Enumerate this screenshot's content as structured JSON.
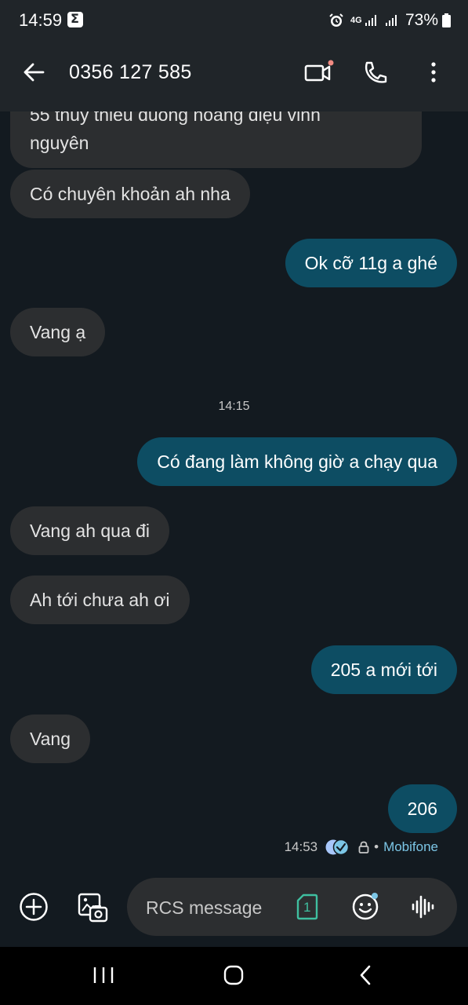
{
  "status_bar": {
    "time": "14:59",
    "network": "4G",
    "battery": "73%"
  },
  "header": {
    "contact": "0356 127 585",
    "icons": [
      "back-arrow-icon",
      "video-call-icon",
      "phone-icon",
      "more-vert-icon"
    ]
  },
  "messages": [
    {
      "direction": "incoming",
      "text_lines": [
        "55 thuy thieu duong hoang diệu vinh",
        "nguyên"
      ]
    },
    {
      "direction": "incoming",
      "text": "Có chuyên khoản ah nha"
    },
    {
      "direction": "outgoing",
      "text": "Ok cỡ 11g a ghé"
    },
    {
      "direction": "incoming",
      "text": "Vang ạ"
    },
    {
      "direction": "divider",
      "text": "14:15"
    },
    {
      "direction": "outgoing",
      "text": "Có đang làm không giờ a chạy qua"
    },
    {
      "direction": "incoming",
      "text": "Vang ah qua đi"
    },
    {
      "direction": "incoming",
      "text": "Ah tới chưa ah ơi"
    },
    {
      "direction": "outgoing",
      "text": "205 a mới tới"
    },
    {
      "direction": "incoming",
      "text": "Vang"
    },
    {
      "direction": "outgoing",
      "text": "206"
    }
  ],
  "last_status": {
    "time": "14:53",
    "dot": "•",
    "carrier": "Mobifone"
  },
  "composer": {
    "placeholder": "RCS message",
    "sim_label": "1"
  },
  "colors": {
    "background": "#131a20",
    "app_bar": "#202529",
    "incoming_bubble": "#2c2e30",
    "outgoing_bubble": "#0d4d63",
    "accent": "#7cc6e6"
  }
}
